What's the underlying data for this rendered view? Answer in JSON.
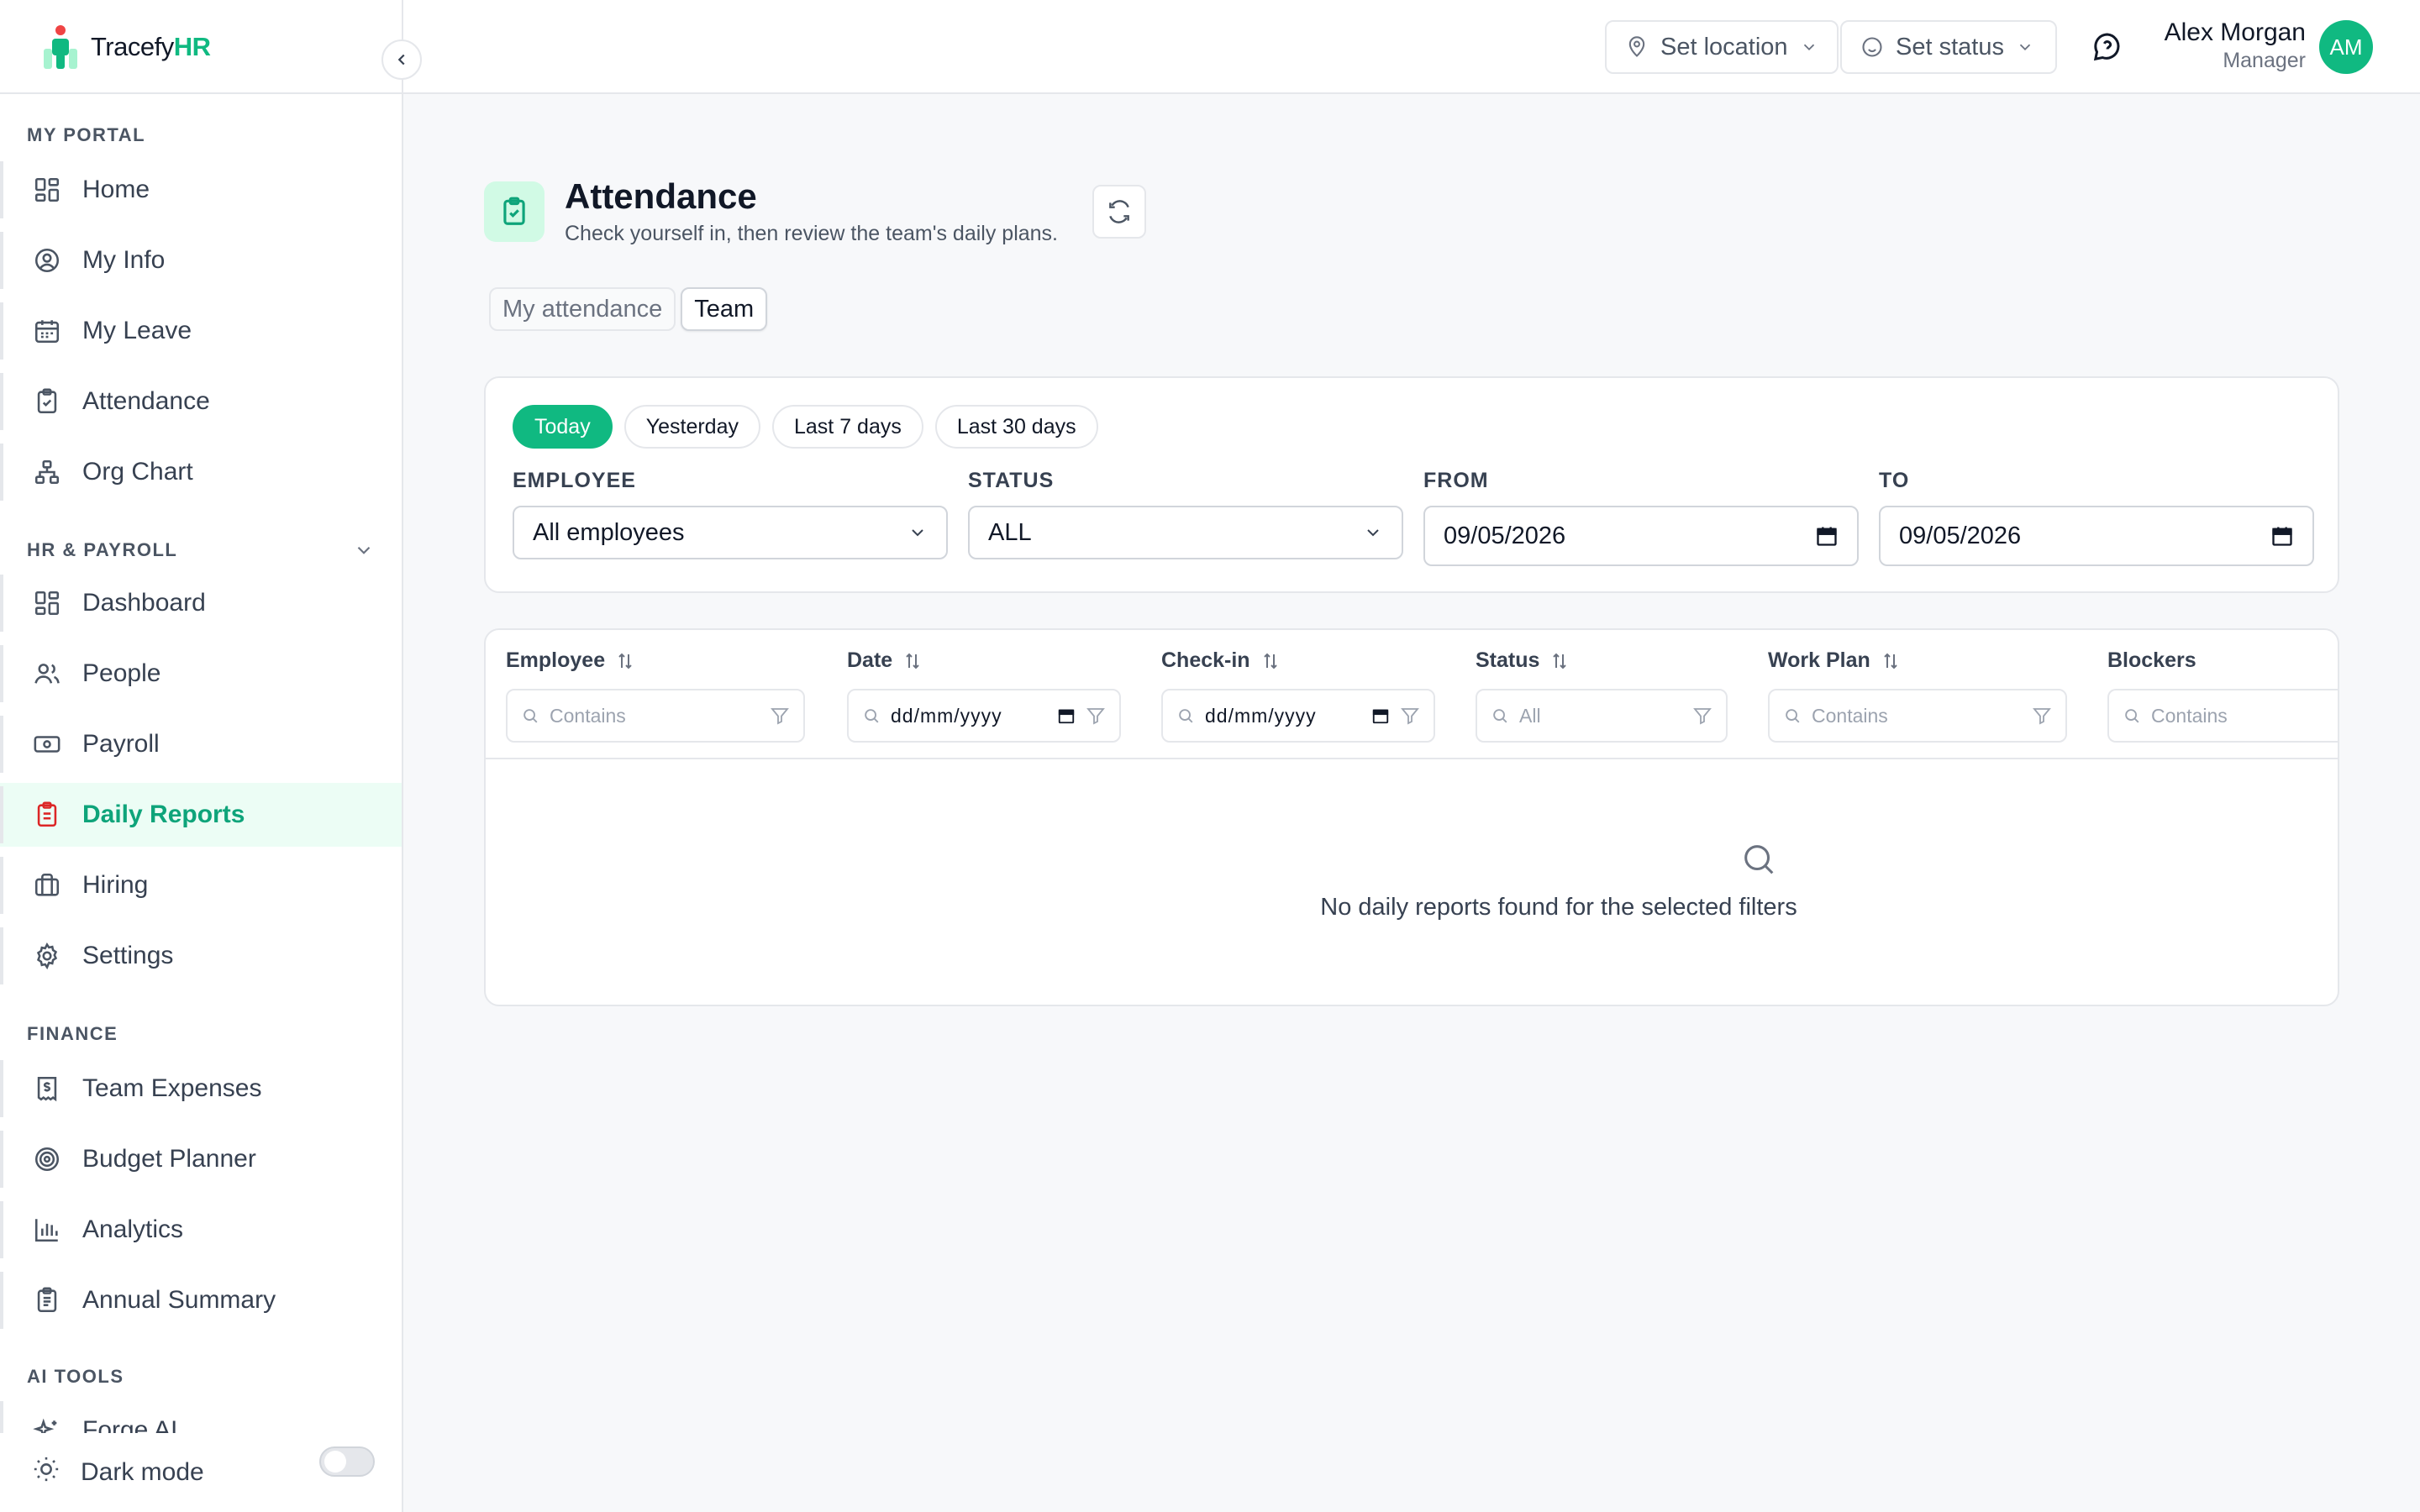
{
  "brand": {
    "name_part1": "Tracefy",
    "name_part2": "HR",
    "accent": "#10b981"
  },
  "sidebar": {
    "sections": [
      {
        "label": "MY PORTAL"
      },
      {
        "label": "HR & PAYROLL"
      },
      {
        "label": "FINANCE"
      },
      {
        "label": "AI TOOLS"
      }
    ],
    "items": [
      {
        "label": "Home",
        "icon": "grid-icon"
      },
      {
        "label": "My Info",
        "icon": "user-circle-icon"
      },
      {
        "label": "My Leave",
        "icon": "calendar-icon"
      },
      {
        "label": "Attendance",
        "icon": "clipboard-check-icon"
      },
      {
        "label": "Org Chart",
        "icon": "org-chart-icon"
      },
      {
        "label": "Dashboard",
        "icon": "grid-icon"
      },
      {
        "label": "People",
        "icon": "users-icon"
      },
      {
        "label": "Payroll",
        "icon": "banknote-icon"
      },
      {
        "label": "Daily Reports",
        "icon": "clipboard-list-icon",
        "active": true
      },
      {
        "label": "Hiring",
        "icon": "briefcase-icon"
      },
      {
        "label": "Settings",
        "icon": "gear-icon"
      },
      {
        "label": "Team Expenses",
        "icon": "receipt-icon"
      },
      {
        "label": "Budget Planner",
        "icon": "target-icon"
      },
      {
        "label": "Analytics",
        "icon": "bar-chart-icon"
      },
      {
        "label": "Annual Summary",
        "icon": "clipboard-icon"
      },
      {
        "label": "Forge AI",
        "icon": "sparkle-icon"
      }
    ],
    "dark_mode_label": "Dark mode"
  },
  "topbar": {
    "set_location": "Set location",
    "set_status": "Set status",
    "user_name": "Alex Morgan",
    "user_role": "Manager",
    "avatar_initials": "AM"
  },
  "page": {
    "title": "Attendance",
    "subtitle": "Check yourself in, then review the team's daily plans.",
    "tabs": [
      "My attendance",
      "Team"
    ]
  },
  "filters": {
    "quick_ranges": [
      "Today",
      "Yesterday",
      "Last 7 days",
      "Last 30 days"
    ],
    "employee_label": "EMPLOYEE",
    "employee_value": "All employees",
    "status_label": "STATUS",
    "status_value": "ALL",
    "from_label": "FROM",
    "from_value": "09/05/2026",
    "to_label": "TO",
    "to_value": "09/05/2026"
  },
  "table": {
    "columns": [
      {
        "header": "Employee",
        "filter": "Contains"
      },
      {
        "header": "Date",
        "filter": "dd/mm/yyyy"
      },
      {
        "header": "Check-in",
        "filter": "dd/mm/yyyy"
      },
      {
        "header": "Status",
        "filter": "All"
      },
      {
        "header": "Work Plan",
        "filter": "Contains"
      },
      {
        "header": "Blockers",
        "filter": "Contains"
      }
    ],
    "empty_message": "No daily reports found for the selected filters"
  }
}
